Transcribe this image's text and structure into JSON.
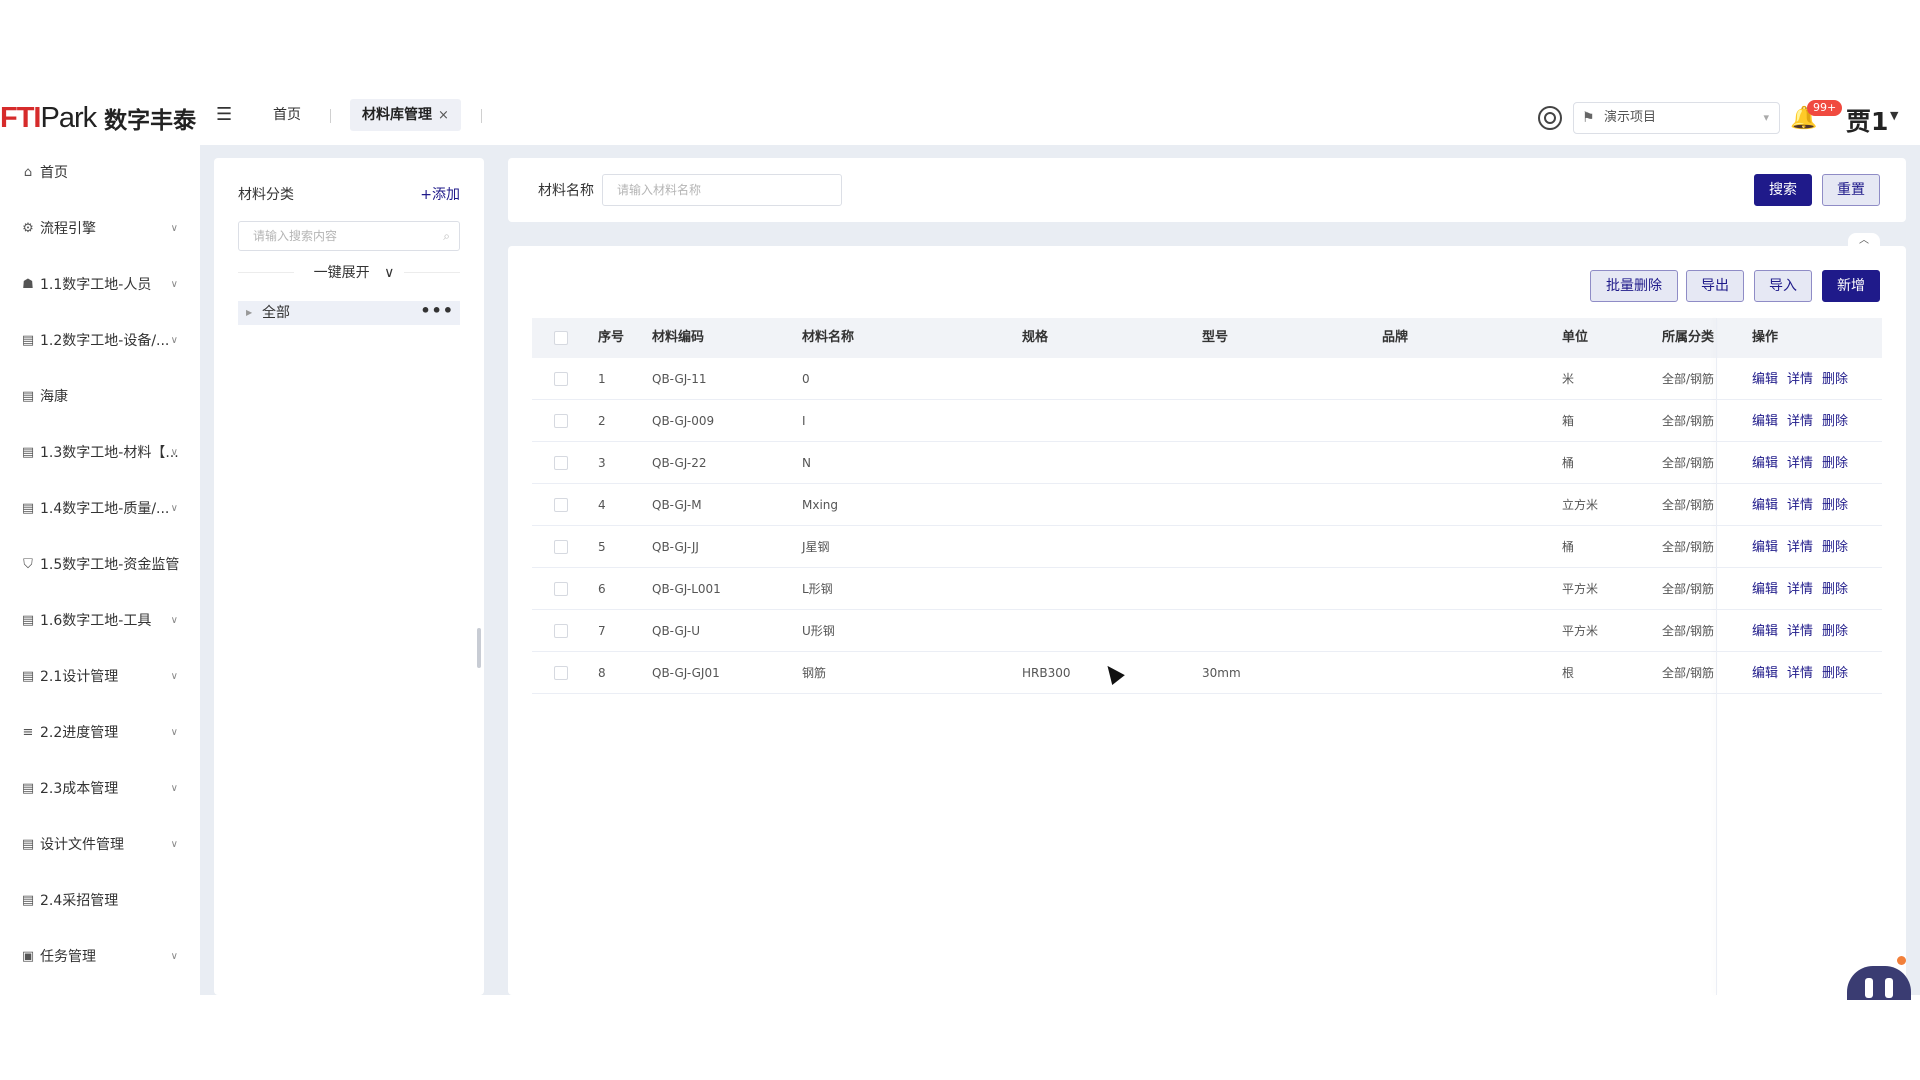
{
  "header": {
    "logo_en_main": "FTI",
    "logo_en_park": "Park",
    "logo_cn": "数字丰泰",
    "tabs": [
      {
        "label": "首页"
      },
      {
        "label": "材料库管理"
      }
    ],
    "tab_close": "×",
    "project": "演示项目",
    "notification_badge": "99+",
    "user": "贾1"
  },
  "sidebar": {
    "items": [
      {
        "label": "首页",
        "icon": "home-icon"
      },
      {
        "label": "流程引擎",
        "icon": "workflow-icon"
      },
      {
        "label": "1.1数字工地-人员",
        "icon": "people-icon"
      },
      {
        "label": "1.2数字工地-设备/...",
        "icon": "document-icon"
      },
      {
        "label": "海康",
        "icon": "document-icon"
      },
      {
        "label": "1.3数字工地-材料【...",
        "icon": "document-icon"
      },
      {
        "label": "1.4数字工地-质量/...",
        "icon": "document-icon"
      },
      {
        "label": "1.5数字工地-资金监管",
        "icon": "shield-icon"
      },
      {
        "label": "1.6数字工地-工具",
        "icon": "document-icon"
      },
      {
        "label": "2.1设计管理",
        "icon": "document-icon"
      },
      {
        "label": "2.2进度管理",
        "icon": "progress-icon"
      },
      {
        "label": "2.3成本管理",
        "icon": "document-icon"
      },
      {
        "label": "设计文件管理",
        "icon": "document-icon"
      },
      {
        "label": "2.4采招管理",
        "icon": "document-icon"
      },
      {
        "label": "任务管理",
        "icon": "briefcase-icon"
      }
    ]
  },
  "category": {
    "title": "材料分类",
    "add": "+添加",
    "search_placeholder": "请输入搜索内容",
    "expand": "一键展开",
    "tree_root": "全部"
  },
  "search": {
    "label": "材料名称",
    "placeholder": "请输入材料名称",
    "search_btn": "搜索",
    "reset_btn": "重置"
  },
  "toolbar": {
    "batch_delete": "批量删除",
    "export": "导出",
    "import": "导入",
    "add": "新增"
  },
  "table": {
    "columns": [
      "序号",
      "材料编码",
      "材料名称",
      "规格",
      "型号",
      "品牌",
      "单位",
      "所属分类",
      "操作"
    ],
    "rows": [
      {
        "no": "1",
        "code": "QB-GJ-11",
        "name": "0",
        "spec": "",
        "model": "",
        "brand": "",
        "unit": "米",
        "category": "全部/钢筋"
      },
      {
        "no": "2",
        "code": "QB-GJ-009",
        "name": "I",
        "spec": "",
        "model": "",
        "brand": "",
        "unit": "箱",
        "category": "全部/钢筋"
      },
      {
        "no": "3",
        "code": "QB-GJ-22",
        "name": "N",
        "spec": "",
        "model": "",
        "brand": "",
        "unit": "桶",
        "category": "全部/钢筋"
      },
      {
        "no": "4",
        "code": "QB-GJ-M",
        "name": "Mxing",
        "spec": "",
        "model": "",
        "brand": "",
        "unit": "立方米",
        "category": "全部/钢筋"
      },
      {
        "no": "5",
        "code": "QB-GJ-JJ",
        "name": "J星钢",
        "spec": "",
        "model": "",
        "brand": "",
        "unit": "桶",
        "category": "全部/钢筋"
      },
      {
        "no": "6",
        "code": "QB-GJ-L001",
        "name": "L形钢",
        "spec": "",
        "model": "",
        "brand": "",
        "unit": "平方米",
        "category": "全部/钢筋"
      },
      {
        "no": "7",
        "code": "QB-GJ-U",
        "name": "U形钢",
        "spec": "",
        "model": "",
        "brand": "",
        "unit": "平方米",
        "category": "全部/钢筋"
      },
      {
        "no": "8",
        "code": "QB-GJ-GJ01",
        "name": "钢筋",
        "spec": "HRB300",
        "model": "30mm",
        "brand": "",
        "unit": "根",
        "category": "全部/钢筋"
      }
    ],
    "actions": {
      "edit": "编辑",
      "detail": "详情",
      "delete": "删除"
    }
  },
  "colors": {
    "primary": "#1f1a8a",
    "badge": "#f04a3f",
    "logo_red": "#d62b2b"
  }
}
